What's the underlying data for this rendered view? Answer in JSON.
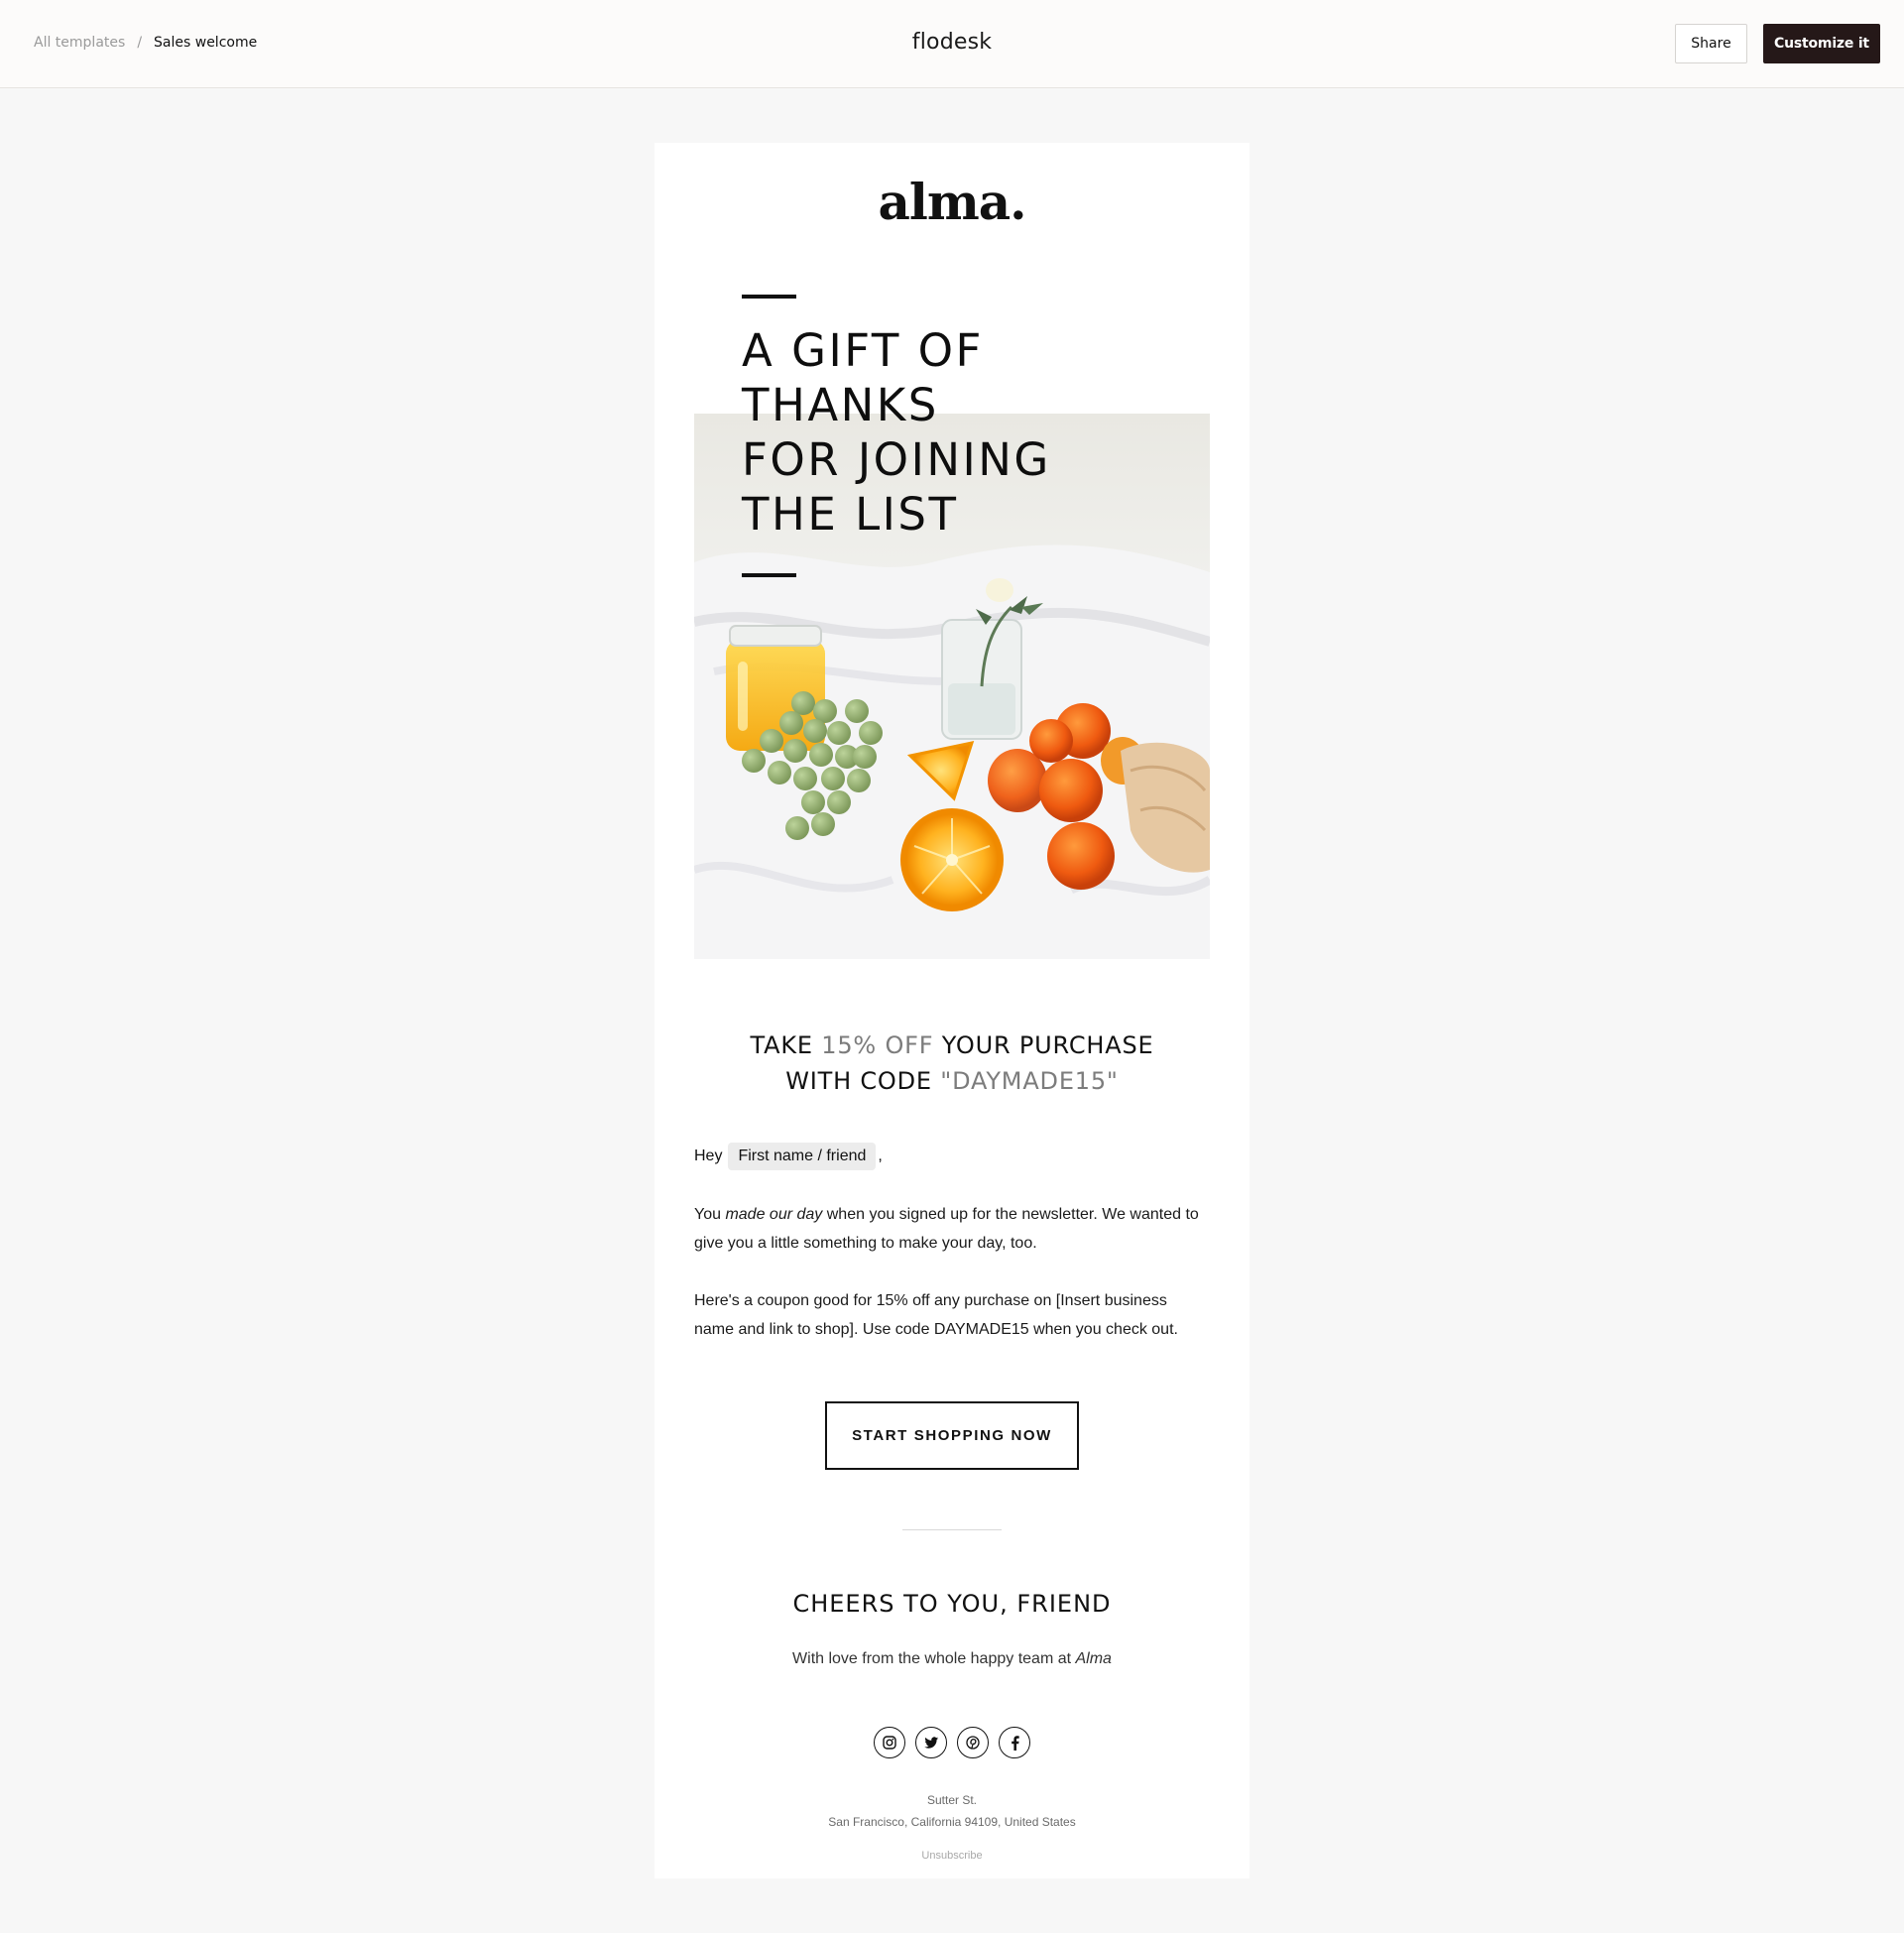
{
  "topbar": {
    "breadcrumb_parent": "All templates",
    "breadcrumb_sep": "/",
    "breadcrumb_current": "Sales welcome",
    "brand": "flodesk",
    "share_label": "Share",
    "customize_label": "Customize it"
  },
  "email": {
    "logo": "alma.",
    "headline": [
      "A GIFT OF",
      "THANKS",
      "FOR JOINING",
      "THE LIST"
    ],
    "offer": {
      "line1_a": "TAKE ",
      "line1_b": "15% OFF",
      "line1_c": " YOUR PURCHASE",
      "line2_a": "WITH CODE ",
      "line2_b": "\"DAYMADE15\""
    },
    "greeting": {
      "hey": "Hey",
      "merge_tag": "First name / friend",
      "comma": ","
    },
    "para1": {
      "a": "You ",
      "em": "made our day",
      "b": " when you signed up for the newsletter. We wanted to give you a little something to make your day, too."
    },
    "para2": "Here's a coupon good for 15% off any purchase on [Insert business name and link to shop]. Use code DAYMADE15 when you check out.",
    "cta_label": "START SHOPPING NOW",
    "signoff": "CHEERS TO YOU, FRIEND",
    "love": {
      "a": "With love from the whole happy team at ",
      "em": "Alma"
    },
    "socials": [
      "instagram-icon",
      "twitter-icon",
      "pinterest-icon",
      "facebook-icon"
    ],
    "address_line1": "Sutter St.",
    "address_line2": "San Francisco, California 94109, United States",
    "unsubscribe": "Unsubscribe"
  },
  "colors": {
    "page_bg": "#f7f7f7",
    "topbar_bg": "#fcfbfa",
    "customize_bg": "#251818",
    "offer_muted": "#7c7c7c"
  }
}
